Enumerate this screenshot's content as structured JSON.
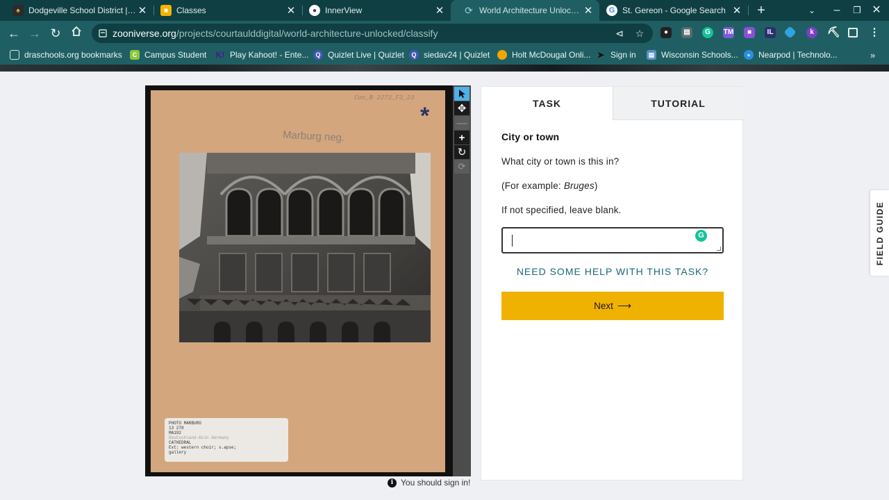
{
  "browser": {
    "tabs": [
      {
        "title": "Dodgeville School District | Do",
        "icon": "district-logo-icon",
        "active": false
      },
      {
        "title": "Classes",
        "icon": "google-classroom-icon",
        "active": false
      },
      {
        "title": "InnerView",
        "icon": "innerview-icon",
        "active": false
      },
      {
        "title": "World Architecture Unlocked »",
        "icon": "zooniverse-icon",
        "active": true
      },
      {
        "title": "St. Gereon - Google Search",
        "icon": "google-icon",
        "active": false
      }
    ],
    "url_host": "zooniverse.org",
    "url_path": "/projects/courtaulddigital/world-architecture-unlocked/classify",
    "bookmarks": [
      {
        "label": "draschools.org bookmarks",
        "icon": "folder-icon"
      },
      {
        "label": "Campus Student",
        "icon": "campus-icon"
      },
      {
        "label": "Play Kahoot! - Ente...",
        "icon": "kahoot-icon"
      },
      {
        "label": "Quizlet Live | Quizlet",
        "icon": "quizlet-icon"
      },
      {
        "label": "siedav24 | Quizlet",
        "icon": "quizlet-icon"
      },
      {
        "label": "Holt McDougal Onli...",
        "icon": "holt-icon"
      },
      {
        "label": "Sign in",
        "icon": "sign-in-icon"
      },
      {
        "label": "Wisconsin Schools...",
        "icon": "wisconsin-icon"
      },
      {
        "label": "Nearpod | Technolo...",
        "icon": "nearpod-icon"
      }
    ]
  },
  "subject": {
    "reference": "Con_B 2272_F3_23",
    "caption": "Marburg neg.",
    "label_lines": [
      "PHOTO MARBURG",
      "13 278",
      "MA192",
      "Deutschland-Koln  Germany",
      "CATHEDRAL",
      "Ext: western choir; s.apse;",
      "gallery"
    ],
    "signin_message": "You should sign in!"
  },
  "task_panel": {
    "tabs": {
      "task": "TASK",
      "tutorial": "TUTORIAL"
    },
    "question_title": "City or town",
    "question": "What city or town is this in?",
    "example_prefix": "(For example: ",
    "example_value": "Bruges",
    "example_suffix": ")",
    "instruction": "If not specified, leave blank.",
    "answer_value": "",
    "help_link": "NEED SOME HELP WITH THIS TASK?",
    "next_label": "Next",
    "accent_color": "#f0b200"
  },
  "field_guide_label": "FIELD GUIDE"
}
